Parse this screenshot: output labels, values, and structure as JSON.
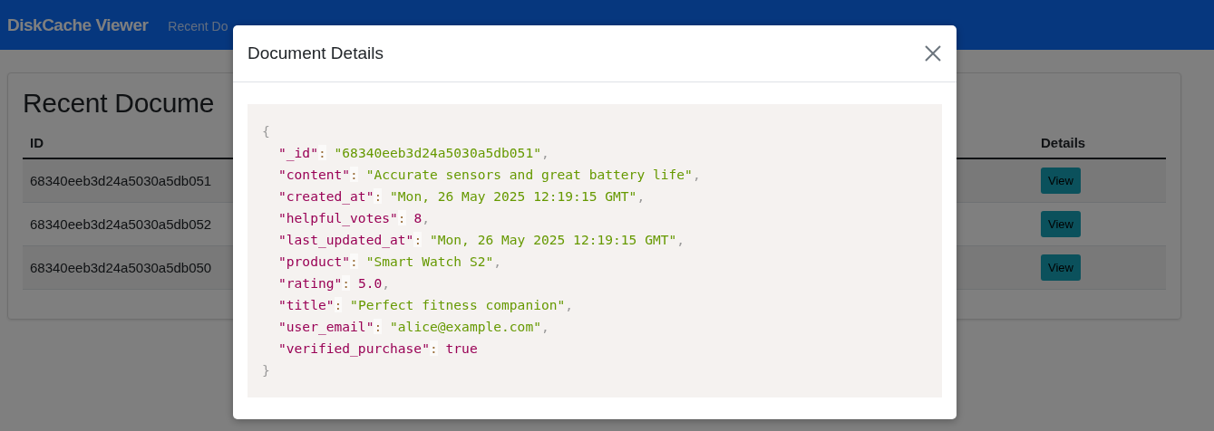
{
  "navbar": {
    "brand": "DiskCache Viewer",
    "links": [
      {
        "label": "Recent Do"
      }
    ]
  },
  "page": {
    "heading": "Recent Docume",
    "table": {
      "columns": [
        "ID",
        "Details"
      ],
      "rows": [
        {
          "id": "68340eeb3d24a5030a5db051",
          "action": "View"
        },
        {
          "id": "68340eeb3d24a5030a5db052",
          "action": "View"
        },
        {
          "id": "68340eeb3d24a5030a5db050",
          "action": "View"
        }
      ]
    }
  },
  "modal": {
    "title": "Document Details",
    "code": {
      "open": "{",
      "close": "}",
      "lines": [
        {
          "key": "\"_id\"",
          "sep": ":",
          "value": "\"68340eeb3d24a5030a5db051\"",
          "kind": "string",
          "trail": ","
        },
        {
          "key": "\"content\"",
          "sep": ":",
          "value": "\"Accurate sensors and great battery life\"",
          "kind": "string",
          "trail": ","
        },
        {
          "key": "\"created_at\"",
          "sep": ":",
          "value": "\"Mon, 26 May 2025 12:19:15 GMT\"",
          "kind": "string",
          "trail": ","
        },
        {
          "key": "\"helpful_votes\"",
          "sep": ":",
          "value": "8",
          "kind": "number",
          "trail": ","
        },
        {
          "key": "\"last_updated_at\"",
          "sep": ":",
          "value": "\"Mon, 26 May 2025 12:19:15 GMT\"",
          "kind": "string",
          "trail": ","
        },
        {
          "key": "\"product\"",
          "sep": ":",
          "value": "\"Smart Watch S2\"",
          "kind": "string",
          "trail": ","
        },
        {
          "key": "\"rating\"",
          "sep": ":",
          "value": "5.0",
          "kind": "number",
          "trail": ","
        },
        {
          "key": "\"title\"",
          "sep": ":",
          "value": "\"Perfect fitness companion\"",
          "kind": "string",
          "trail": ","
        },
        {
          "key": "\"user_email\"",
          "sep": ":",
          "value": "\"alice@example.com\"",
          "kind": "string",
          "trail": ","
        },
        {
          "key": "\"verified_purchase\"",
          "sep": ":",
          "value": "true",
          "kind": "boolean"
        }
      ]
    }
  }
}
